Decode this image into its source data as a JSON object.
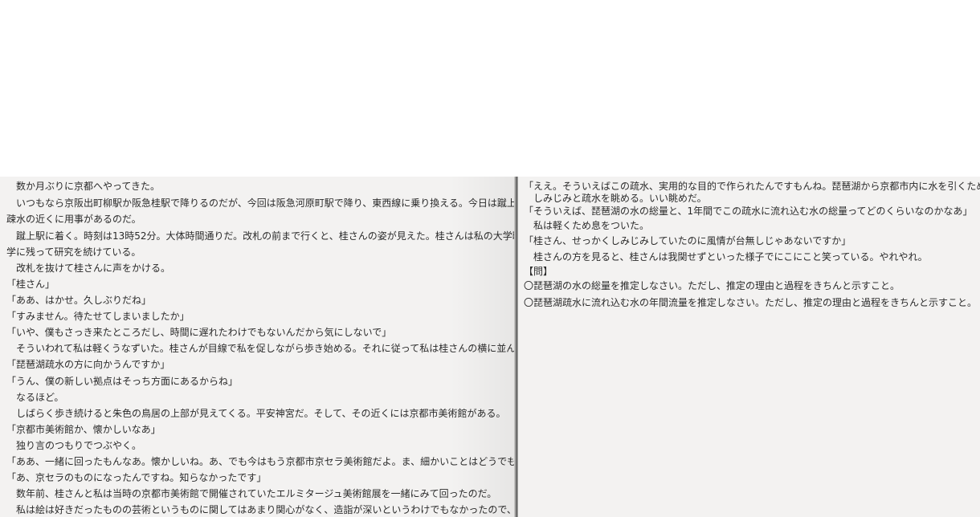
{
  "left_page": {
    "lines": [
      "　数か月ぶりに京都へやってきた。",
      "　いつもなら京阪出町柳駅か阪急桂駅で降りるのだが、今回は阪急河原町駅で降り、東西線に乗り換える。今日は蹴上にある琵琶湖",
      "疎水の近くに用事があるのだ。",
      "　蹴上駅に着く。時刻は13時52分。大体時間通りだ。改札の前まで行くと、桂さんの姿が見えた。桂さんは私の大学時代の先輩で、大",
      "学に残って研究を続けている。",
      "　改札を抜けて桂さんに声をかける。",
      "「桂さん」",
      "「ああ、はかせ。久しぶりだね」",
      "「すみません。待たせてしまいましたか」",
      "「いや、僕もさっき来たところだし、時間に遅れたわけでもないんだから気にしないで」",
      "　そういわれて私は軽くうなずいた。桂さんが目線で私を促しながら歩き始める。それに従って私は桂さんの横に並んで歩く。",
      "「琵琶湖疏水の方に向かうんですか」",
      "「うん、僕の新しい拠点はそっち方面にあるからね」",
      "　なるほど。",
      "　しばらく歩き続けると朱色の鳥居の上部が見えてくる。平安神宮だ。そして、その近くには京都市美術館がある。",
      "「京都市美術館か、懐かしいなあ」",
      "　独り言のつもりでつぶやく。",
      "「ああ、一緒に回ったもんなあ。懐かしいね。あ、でも今はもう京都市京セラ美術館だよ。ま、細かいことはどうでもいいか」",
      "「あ、京セラのものになったんですね。知らなかったです」",
      "　数年前、桂さんと私は当時の京都市美術館で開催されていたエルミタージュ美術館展を一緒にみて回ったのだ。",
      "　私は絵は好きだったものの芸術というものに関してはあまり関心がなく、造詣が深いというわけでもなかったので、美術館展自体はあまり楽"
    ]
  },
  "right_page": {
    "lines": [
      "「ええ。そういえばこの疏水、実用的な目的で作られたんですもんね。琵琶湖から京都市内に水を引くために」",
      "　しみじみと疏水を眺める。いい眺めだ。",
      "「そういえば、琵琶湖の水の総量と、1年間でこの疏水に流れ込む水の総量ってどのくらいなのかなあ」",
      "　私は軽くため息をついた。",
      "「桂さん、せっかくしみじみしていたのに風情が台無しじゃあないですか」",
      "　桂さんの方を見ると、桂さんは我関せずといった様子でにこにこと笑っている。やれやれ。",
      "【問】",
      "〇琵琶湖の水の総量を推定しなさい。ただし、推定の理由と過程をきちんと示すこと。",
      "〇琵琶湖疏水に流れ込む水の年間流量を推定しなさい。ただし、推定の理由と過程をきちんと示すこと。"
    ]
  }
}
